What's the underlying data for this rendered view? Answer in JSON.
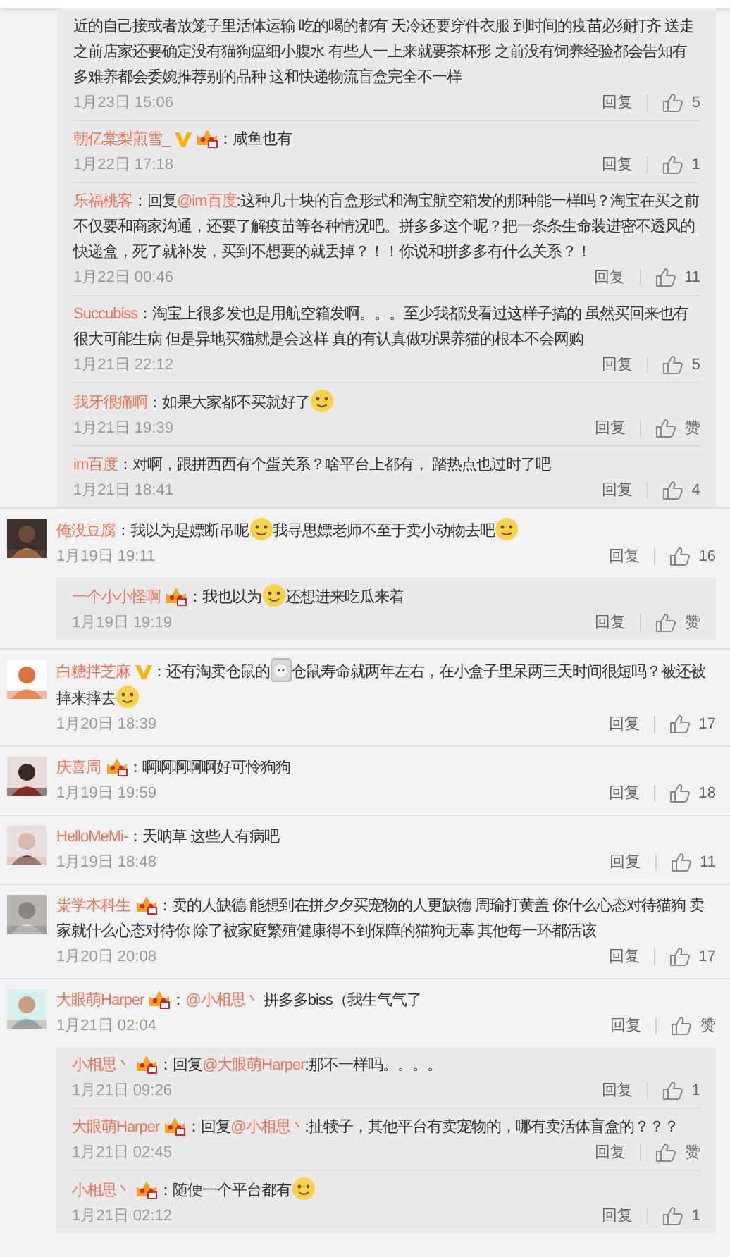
{
  "threads": [
    {
      "kind": "continued",
      "replies": [
        {
          "content": [
            {
              "kind": "text",
              "text": "近的自己接或者放笼子里活体运输 吃的喝的都有 天冷还要穿件衣服 到时间的疫苗必须打齐 送走之前店家还要确定没有猫狗瘟细小腹水 有些人一上来就要茶杯形 之前没有饲养经验都会告知有多难养都会委婉推荐别的品种 这和快递物流盲盒完全不一样"
            }
          ],
          "time": "1月23日 15:06",
          "reply_label": "回复",
          "likes": "5"
        },
        {
          "name": "朝亿棠梨煎雪_",
          "verified": true,
          "member": true,
          "content": [
            {
              "kind": "text",
              "text": "：咸鱼也有"
            }
          ],
          "time": "1月22日 17:18",
          "reply_label": "回复",
          "likes": "1"
        },
        {
          "name": "乐福桃客",
          "verified": false,
          "member": false,
          "content": [
            {
              "kind": "text",
              "text": "：回复"
            },
            {
              "kind": "mention",
              "text": "@im百度"
            },
            {
              "kind": "text",
              "text": ":这种几十块的盲盒形式和淘宝航空箱发的那种能一样吗？淘宝在买之前不仅要和商家沟通，还要了解疫苗等各种情况吧。拼多多这个呢？把一条条生命装进密不透风的快递盒，死了就补发，买到不想要的就丢掉？！！你说和拼多多有什么关系？！"
            }
          ],
          "time": "1月22日 00:46",
          "reply_label": "回复",
          "likes": "11"
        },
        {
          "name": "Succubiss",
          "verified": false,
          "member": false,
          "content": [
            {
              "kind": "text",
              "text": "：淘宝上很多发也是用航空箱发啊。。。至少我都没看过这样子搞的 虽然买回来也有很大可能生病 但是异地买猫就是会这样 真的有认真做功课养猫的根本不会网购"
            }
          ],
          "time": "1月21日 22:12",
          "reply_label": "回复",
          "likes": "5"
        },
        {
          "name": "我牙很痛啊",
          "verified": false,
          "member": false,
          "content": [
            {
              "kind": "text",
              "text": "：如果大家都不买就好了"
            },
            {
              "kind": "emoji"
            }
          ],
          "time": "1月21日 19:39",
          "reply_label": "回复",
          "likes": "赞"
        },
        {
          "name": "im百度",
          "verified": false,
          "member": false,
          "content": [
            {
              "kind": "text",
              "text": "：对啊，跟拼西西有个蛋关系？啥平台上都有， 踏热点也过时了吧"
            }
          ],
          "time": "1月21日 18:41",
          "reply_label": "回复",
          "likes": "4"
        }
      ]
    },
    {
      "kind": "comment",
      "avatar": {
        "kind": "picture"
      },
      "name": "俺没豆腐",
      "verified": false,
      "member": false,
      "content": [
        {
          "kind": "text",
          "text": "：我以为是嫖断吊呢"
        },
        {
          "kind": "emoji"
        },
        {
          "kind": "text",
          "text": "我寻思嫖老师不至于卖小动物去吧"
        },
        {
          "kind": "emoji"
        }
      ],
      "time": "1月19日 19:11",
      "reply_label": "回复",
      "likes": "16",
      "replies": [
        {
          "name": "一个小小怪啊",
          "verified": false,
          "member": true,
          "content": [
            {
              "kind": "text",
              "text": "：我也以为"
            },
            {
              "kind": "emoji"
            },
            {
              "kind": "text",
              "text": "还想进来吃瓜来着"
            }
          ],
          "time": "1月19日 19:19",
          "reply_label": "回复",
          "likes": "赞"
        }
      ]
    },
    {
      "kind": "comment",
      "avatar": {
        "kind": "picture"
      },
      "name": "白糖拌芝麻",
      "verified": true,
      "member": false,
      "content": [
        {
          "kind": "text",
          "text": "：还有淘卖仓鼠的"
        },
        {
          "kind": "sticker"
        },
        {
          "kind": "text",
          "text": "仓鼠寿命就两年左右，在小盒子里呆两三天时间很短吗？被还被摔来摔去"
        },
        {
          "kind": "emoji"
        }
      ],
      "time": "1月20日 18:39",
      "reply_label": "回复",
      "likes": "17"
    },
    {
      "kind": "comment",
      "avatar": {
        "kind": "picture"
      },
      "name": "庆喜周",
      "verified": false,
      "member": true,
      "content": [
        {
          "kind": "text",
          "text": "：啊啊啊啊啊好可怜狗狗"
        }
      ],
      "time": "1月19日 19:59",
      "reply_label": "回复",
      "likes": "18"
    },
    {
      "kind": "comment",
      "avatar": {
        "kind": "picture"
      },
      "name": "HelloMeMi-",
      "verified": false,
      "member": false,
      "content": [
        {
          "kind": "text",
          "text": "：天呐草 这些人有病吧"
        }
      ],
      "time": "1月19日 18:48",
      "reply_label": "回复",
      "likes": "11"
    },
    {
      "kind": "comment",
      "avatar": {
        "kind": "picture"
      },
      "name": "粜学本科生",
      "verified": false,
      "member": true,
      "content": [
        {
          "kind": "text",
          "text": "：卖的人缺德 能想到在拼夕夕买宠物的人更缺德 周瑜打黄盖 你什么心态对待猫狗 卖家就什么心态对待你 除了被家庭繁殖健康得不到保障的猫狗无辜 其他每一环都活该"
        }
      ],
      "time": "1月20日 20:08",
      "reply_label": "回复",
      "likes": "17"
    },
    {
      "kind": "comment",
      "avatar": {
        "kind": "picture"
      },
      "name": "大眼萌Harper",
      "verified": false,
      "member": true,
      "content": [
        {
          "kind": "text",
          "text": "："
        },
        {
          "kind": "mention",
          "text": "@小相思丶"
        },
        {
          "kind": "text",
          "text": "  拼多多biss（我生气气了"
        }
      ],
      "time": "1月21日 02:04",
      "reply_label": "回复",
      "likes": "赞",
      "replies": [
        {
          "name": "小相思丶",
          "verified": false,
          "member": true,
          "content": [
            {
              "kind": "text",
              "text": "：回复"
            },
            {
              "kind": "mention",
              "text": "@大眼萌Harper"
            },
            {
              "kind": "text",
              "text": ":那不一样吗。。。。"
            }
          ],
          "time": "1月21日 09:26",
          "reply_label": "回复",
          "likes": "1"
        },
        {
          "name": "大眼萌Harper",
          "verified": false,
          "member": true,
          "content": [
            {
              "kind": "text",
              "text": "：回复"
            },
            {
              "kind": "mention",
              "text": "@小相思丶"
            },
            {
              "kind": "text",
              "text": ":扯犊子，其他平台有卖宠物的，哪有卖活体盲盒的？？？"
            }
          ],
          "time": "1月21日 02:45",
          "reply_label": "回复",
          "likes": "赞"
        },
        {
          "name": "小相思丶",
          "verified": false,
          "member": true,
          "content": [
            {
              "kind": "text",
              "text": "：随便一个平台都有"
            },
            {
              "kind": "emoji"
            }
          ],
          "time": "1月21日 02:12",
          "reply_label": "回复",
          "likes": "1"
        }
      ]
    }
  ]
}
